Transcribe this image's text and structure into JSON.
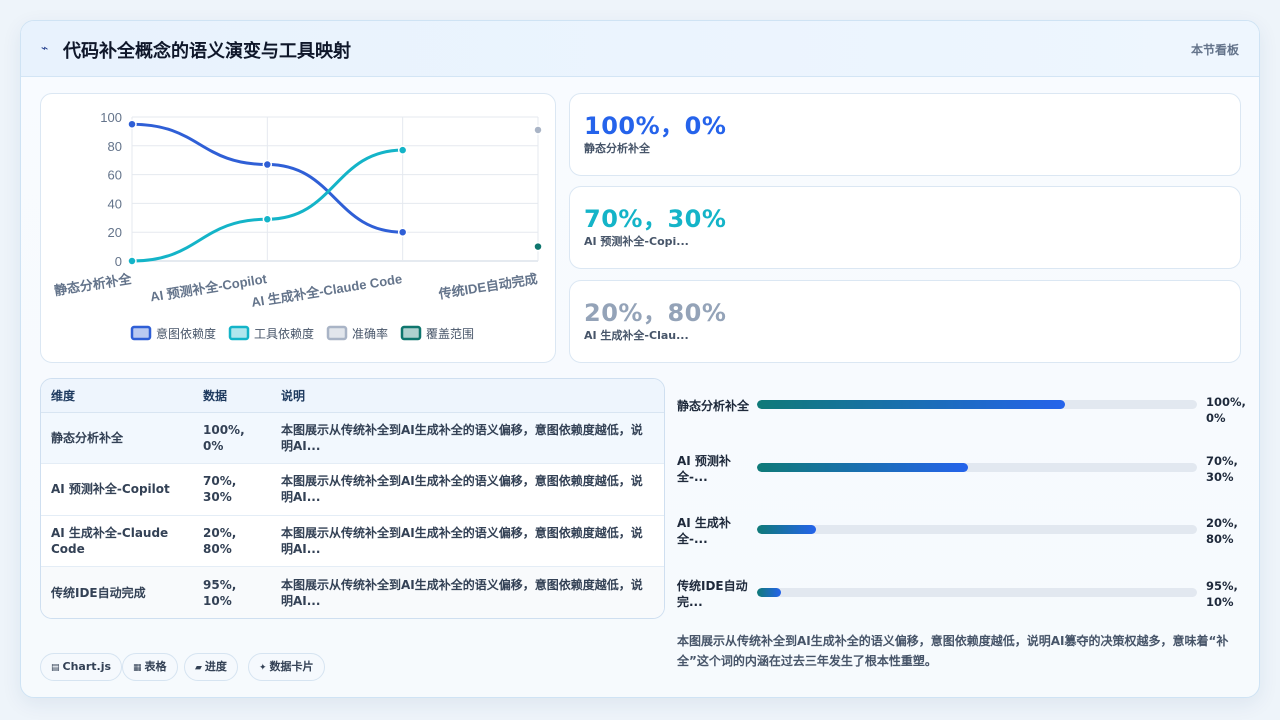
{
  "header": {
    "title": "代码补全概念的语义演变与工具映射",
    "badge": "本节看板"
  },
  "chart_data": {
    "type": "line",
    "categories": [
      "静态分析补全",
      "AI 预测补全-Copilot",
      "AI 生成补全-Claude Code",
      "传统IDE自动完成"
    ],
    "series": [
      {
        "name": "意图依赖度",
        "values": [
          95,
          67,
          20,
          null
        ],
        "color": "#2f5fd6"
      },
      {
        "name": "工具依赖度",
        "values": [
          0,
          29,
          77,
          null
        ],
        "color": "#14b4c8"
      },
      {
        "name": "准确率",
        "values": [
          null,
          null,
          null,
          91
        ],
        "color": "#a9b4c6"
      },
      {
        "name": "覆盖范围",
        "values": [
          null,
          null,
          null,
          10
        ],
        "color": "#0f766e"
      }
    ],
    "yticks": [
      "0",
      "20",
      "40",
      "60",
      "80",
      "100"
    ],
    "ylim": [
      0,
      100
    ],
    "grid": true,
    "legend": "bottom"
  },
  "stats": [
    {
      "value": "100%，0%",
      "label": "静态分析补全",
      "color": "#2563eb"
    },
    {
      "value": "70%，30%",
      "label": "AI 预测补全-Copi...",
      "color": "#14b4c8"
    },
    {
      "value": "20%，80%",
      "label": "AI 生成补全-Clau...",
      "color": "#94a3b8"
    }
  ],
  "table": {
    "headers": [
      "维度",
      "数据",
      "说明"
    ],
    "rows": [
      {
        "dim": "静态分析补全",
        "data": "100%, 0%",
        "desc": "本图展示从传统补全到AI生成补全的语义偏移，意图依赖度越低，说明AI..."
      },
      {
        "dim": "AI 预测补全-Copilot",
        "data": "70%, 30%",
        "desc": "本图展示从传统补全到AI生成补全的语义偏移，意图依赖度越低，说明AI..."
      },
      {
        "dim": "AI 生成补全-Claude Code",
        "data": "20%, 80%",
        "desc": "本图展示从传统补全到AI生成补全的语义偏移，意图依赖度越低，说明AI..."
      },
      {
        "dim": "传统IDE自动完成",
        "data": "95%, 10%",
        "desc": "本图展示从传统补全到AI生成补全的语义偏移，意图依赖度越低，说明AI..."
      }
    ]
  },
  "progress": [
    {
      "label": "静态分析补全",
      "value": "100%, 0%",
      "fill": 0.7
    },
    {
      "label": "AI 预测补全-...",
      "value": "70%, 30%",
      "fill": 0.48
    },
    {
      "label": "AI 生成补全-...",
      "value": "20%, 80%",
      "fill": 0.135
    },
    {
      "label": "传统IDE自动完...",
      "value": "95%, 10%",
      "fill": 0.055
    }
  ],
  "summary": "本图展示从传统补全到AI生成补全的语义偏移，意图依赖度越低，说明AI篡夺的决策权越多，意味着“补全”这个词的内涵在过去三年发生了根本性重塑。",
  "chips": [
    {
      "icon": "▤",
      "label": "Chart.js"
    },
    {
      "icon": "▦",
      "label": "表格"
    },
    {
      "icon": "▰",
      "label": "进度"
    },
    {
      "icon": "✦",
      "label": "数据卡片"
    }
  ]
}
